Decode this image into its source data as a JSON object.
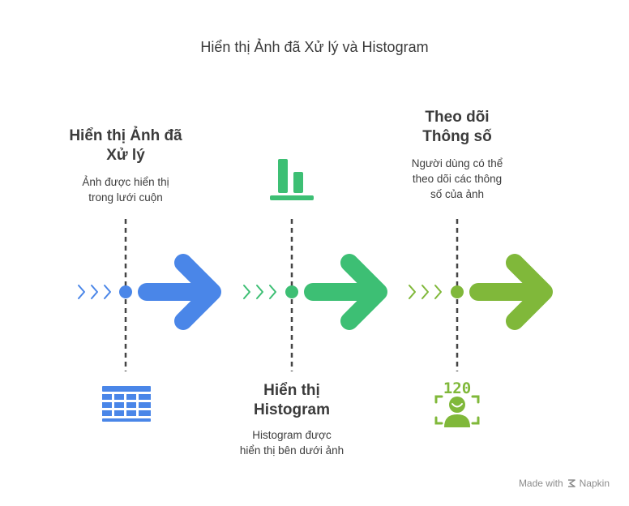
{
  "title": "Hiển thị Ảnh đã Xử lý và Histogram",
  "steps": [
    {
      "heading_line1": "Hiển thị Ảnh đã",
      "heading_line2": "Xử lý",
      "desc_line1": "Ảnh được hiển thị",
      "desc_line2": "trong lưới cuộn",
      "icon": "grid-table-icon",
      "color": "#4a86e8"
    },
    {
      "heading_line1": "Hiển thị",
      "heading_line2": "Histogram",
      "desc_line1": "Histogram được",
      "desc_line2": "hiển thị bên dưới ảnh",
      "icon": "bar-chart-icon",
      "color": "#3dbf74"
    },
    {
      "heading_line1": "Theo dõi",
      "heading_line2": "Thông số",
      "desc_line1": "Người dùng có thể",
      "desc_line2": "theo dõi các thông",
      "desc_line3": "số của ảnh",
      "icon": "face-tracking-icon",
      "icon_text": "120",
      "color": "#80b83a"
    }
  ],
  "footer": {
    "made_with": "Made with",
    "brand": "Napkin"
  }
}
